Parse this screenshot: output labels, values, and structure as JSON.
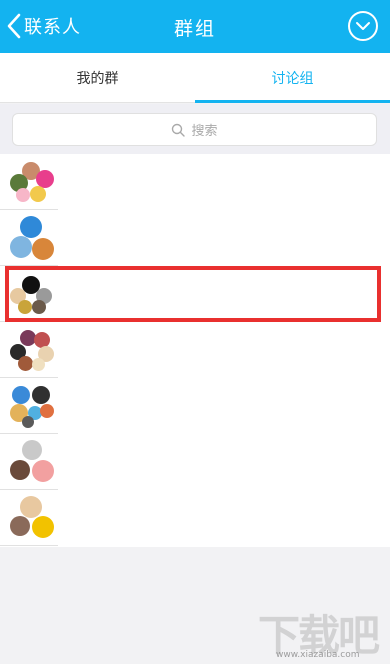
{
  "header": {
    "back_label": "联系人",
    "title": "群组",
    "action_icon": "chevron-down-circle-icon"
  },
  "tabs": [
    {
      "label": "我的群",
      "active": false
    },
    {
      "label": "讨论组",
      "active": true
    }
  ],
  "search": {
    "placeholder": "搜索",
    "icon": "search-icon"
  },
  "groups_count": 7,
  "highlighted_row_index": 2,
  "colors": {
    "accent": "#13b3f0",
    "highlight": "#e9302f",
    "background": "#f2f2f4"
  },
  "watermark": {
    "main": "下载吧",
    "sub": "www.xiazaiba.com"
  }
}
